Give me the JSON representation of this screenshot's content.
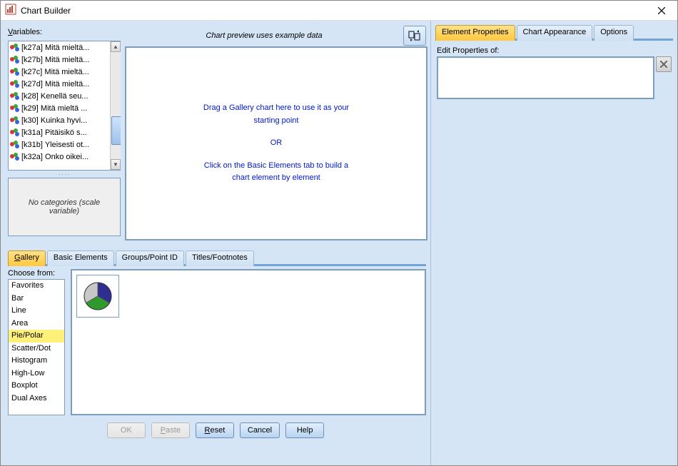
{
  "window": {
    "title": "Chart Builder"
  },
  "labels": {
    "variables": "ariables:",
    "variables_ul": "V",
    "preview": "Chart preview uses example data",
    "nocat": "No categories (scale variable)",
    "choose": "hoose from:",
    "choose_ul": "C",
    "editprops": "Edit Properties of:"
  },
  "canvas": {
    "line1": "Drag a Gallery chart here to use it as your",
    "line2": "starting point",
    "or": "OR",
    "line3": "Click on the Basic Elements tab to build a",
    "line4": "chart element by element"
  },
  "variables": [
    "[k27a] Mitä mieltä...",
    "[k27b] Mitä mieltä...",
    "[k27c] Mitä mieltä...",
    "[k27d] Mitä mieltä...",
    "[k28] Kenellä seu...",
    "[k29] Mitä mieltä ...",
    "[k30] Kuinka hyvi...",
    "[k31a] Pitäisikö s...",
    "[k31b] Yleisesti ot...",
    "[k32a] Onko oikei..."
  ],
  "tabs_mid": {
    "gallery": "allery",
    "gallery_ul": "G",
    "basic": "Basic Elements",
    "groups": "Groups/Point ID",
    "titles": "Titles/Footnotes"
  },
  "tabs_right": {
    "elem": "Element Properties",
    "appear": "Chart Appearance",
    "options": "Options"
  },
  "choose_list": [
    "Favorites",
    "Bar",
    "Line",
    "Area",
    "Pie/Polar",
    "Scatter/Dot",
    "Histogram",
    "High-Low",
    "Boxplot",
    "Dual Axes"
  ],
  "choose_selected_index": 4,
  "buttons": {
    "ok": "OK",
    "paste": "aste",
    "paste_ul": "P",
    "reset": "eset",
    "reset_ul": "R",
    "cancel": "Cancel",
    "help": "Help"
  }
}
